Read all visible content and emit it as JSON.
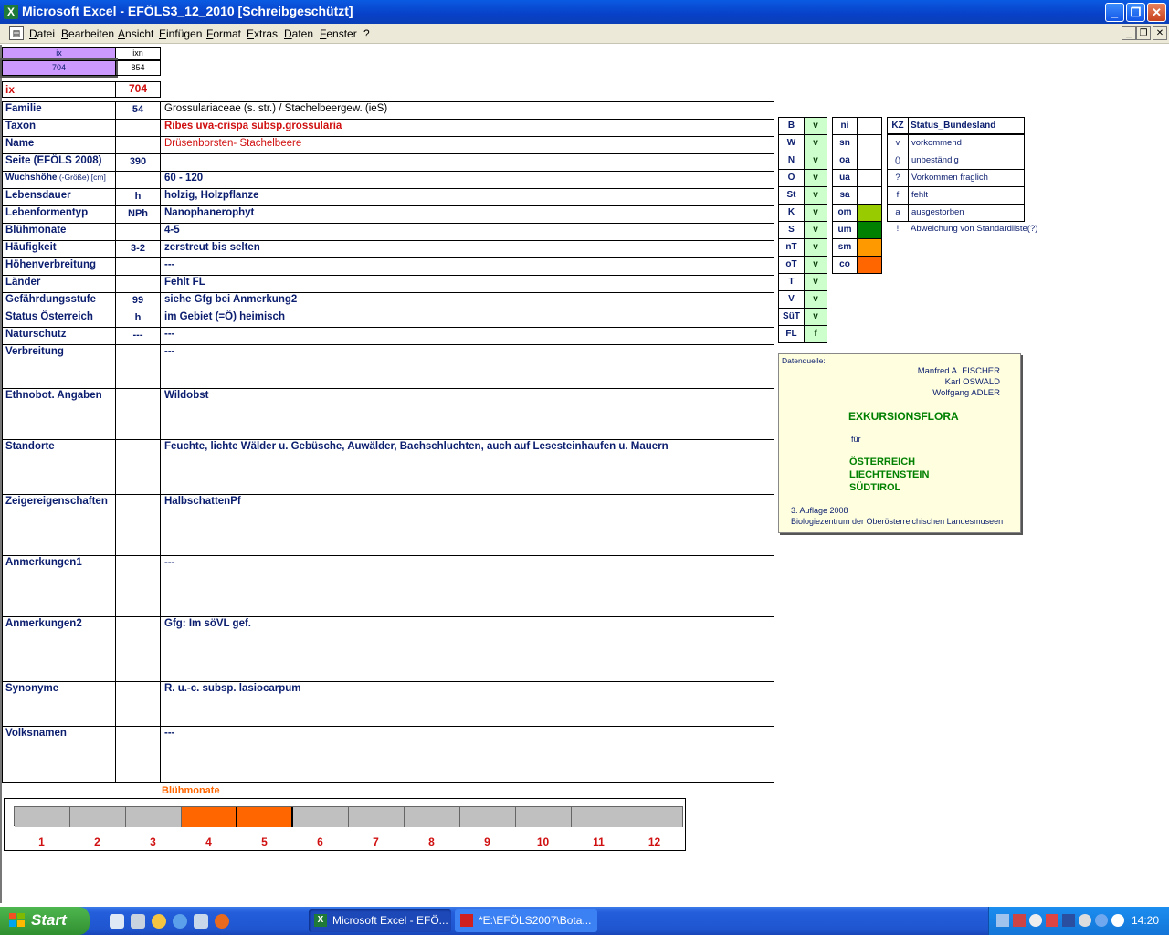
{
  "window": {
    "title": "Microsoft Excel - EFÖLS3_12_2010  [Schreibgeschützt]",
    "minimize": "_",
    "restore": "❐",
    "close": "✕"
  },
  "menu": {
    "items": [
      "Datei",
      "Bearbeiten",
      "Ansicht",
      "Einfügen",
      "Format",
      "Extras",
      "Daten",
      "Fenster",
      "?"
    ]
  },
  "index": {
    "ix_label": "ix",
    "ixn_label": "ixn",
    "ix_value": "704",
    "ixn_value": "854",
    "main_label": "ix",
    "main_value": "704"
  },
  "rows": [
    {
      "label": "Familie",
      "code": "54",
      "value": "Grossulariaceae (s. str.)  /  Stachelbeergew. (ieS)"
    },
    {
      "label": "Taxon",
      "code": "",
      "value": "Ribes uva-crispa subsp.grossularia"
    },
    {
      "label": "Name",
      "code": "",
      "value": "Drüsenborsten- Stachelbeere"
    },
    {
      "label": "Seite (EFÖLS 2008)",
      "code": "390",
      "value": ""
    },
    {
      "label": "Wuchshöhe",
      "label_suffix": " (-Größe) [cm]",
      "code": "",
      "value": "60 - 120"
    },
    {
      "label": "Lebensdauer",
      "code": "h",
      "value": "holzig, Holzpflanze"
    },
    {
      "label": "Lebenformentyp",
      "code": "NPh",
      "value": "Nanophanerophyt"
    },
    {
      "label": "Blühmonate",
      "code": "",
      "value": "4-5"
    },
    {
      "label": "Häufigkeit",
      "code": "3-2",
      "value": "zerstreut bis selten"
    },
    {
      "label": "Höhenverbreitung",
      "code": "",
      "value": "---"
    },
    {
      "label": "Länder",
      "code": "",
      "value": "Fehlt FL"
    },
    {
      "label": "Gefährdungsstufe",
      "code": "99",
      "value": "siehe Gfg bei Anmerkung2"
    },
    {
      "label": "Status Österreich",
      "code": "h",
      "value": "im Gebiet (=Ö) heimisch"
    },
    {
      "label": "Naturschutz",
      "code": "---",
      "value": "---"
    },
    {
      "label": "Verbreitung",
      "code": "",
      "value": "---"
    },
    {
      "label": "Ethnobot. Angaben",
      "code": "",
      "value": "Wildobst"
    },
    {
      "label": "Standorte",
      "code": "",
      "value": "Feuchte, lichte Wälder u. Gebüsche, Auwälder, Bachschluchten, auch auf Lesesteinhaufen u. Mauern"
    },
    {
      "label": "Zeigereigenschaften",
      "code": "",
      "value": "HalbschattenPf"
    },
    {
      "label": "Anmerkungen1",
      "code": "",
      "value": "---"
    },
    {
      "label": "Anmerkungen2",
      "code": "",
      "value": "Gfg: Im söVL gef."
    },
    {
      "label": "Synonyme",
      "code": "",
      "value": "R. u.-c. subsp. lasiocarpum"
    },
    {
      "label": "Volksnamen",
      "code": "",
      "value": "---"
    }
  ],
  "states": [
    {
      "code": "B",
      "val": "v"
    },
    {
      "code": "W",
      "val": "v"
    },
    {
      "code": "N",
      "val": "v"
    },
    {
      "code": "O",
      "val": "v"
    },
    {
      "code": "St",
      "val": "v"
    },
    {
      "code": "K",
      "val": "v"
    },
    {
      "code": "S",
      "val": "v"
    },
    {
      "code": "nT",
      "val": "v"
    },
    {
      "code": "oT",
      "val": "v"
    },
    {
      "code": "T",
      "val": "v"
    },
    {
      "code": "V",
      "val": "v"
    },
    {
      "code": "SüT",
      "val": "v"
    },
    {
      "code": "FL",
      "val": "f"
    }
  ],
  "heights": [
    {
      "code": "ni",
      "color": "#ffffff"
    },
    {
      "code": "sn",
      "color": "#ffffff"
    },
    {
      "code": "oa",
      "color": "#ffffff"
    },
    {
      "code": "ua",
      "color": "#ffffff"
    },
    {
      "code": "sa",
      "color": "#ffffff"
    },
    {
      "code": "om",
      "color": "#99cc00"
    },
    {
      "code": "um",
      "color": "#008000"
    },
    {
      "code": "sm",
      "color": "#ff9900"
    },
    {
      "code": "co",
      "color": "#ff6600"
    }
  ],
  "legend": {
    "kz_header": "KZ",
    "status_header": "Status_Bundesland",
    "items": [
      {
        "kz": "v",
        "text": "vorkommend"
      },
      {
        "kz": "()",
        "text": "unbeständig"
      },
      {
        "kz": "?",
        "text": "Vorkommen fraglich"
      },
      {
        "kz": "f",
        "text": "fehlt"
      },
      {
        "kz": "a",
        "text": "ausgestorben"
      },
      {
        "kz": "!",
        "text": "Abweichung von Standardliste(?)"
      }
    ]
  },
  "source": {
    "label": "Datenquelle:",
    "authors": [
      "Manfred A. FISCHER",
      "Karl OSWALD",
      "Wolfgang ADLER"
    ],
    "title": "EXKURSIONSFLORA",
    "fuer": "für",
    "countries": [
      "ÖSTERREICH",
      "LIECHTENSTEIN",
      "SÜDTIROL"
    ],
    "edition": "3. Auflage 2008",
    "publisher": "Biologiezentrum der Oberösterreichischen Landesmuseen"
  },
  "bloom": {
    "title": "Blühmonate",
    "months": [
      "1",
      "2",
      "3",
      "4",
      "5",
      "6",
      "7",
      "8",
      "9",
      "10",
      "11",
      "12"
    ],
    "active": [
      4,
      5
    ],
    "active_color": "#ff6600",
    "inactive_color": "#c0c0c0"
  },
  "taskbar": {
    "start": "Start",
    "tasks": [
      "Microsoft Excel - EFÖ...",
      "*E:\\EFÖLS2007\\Bota..."
    ],
    "clock": "14:20"
  }
}
